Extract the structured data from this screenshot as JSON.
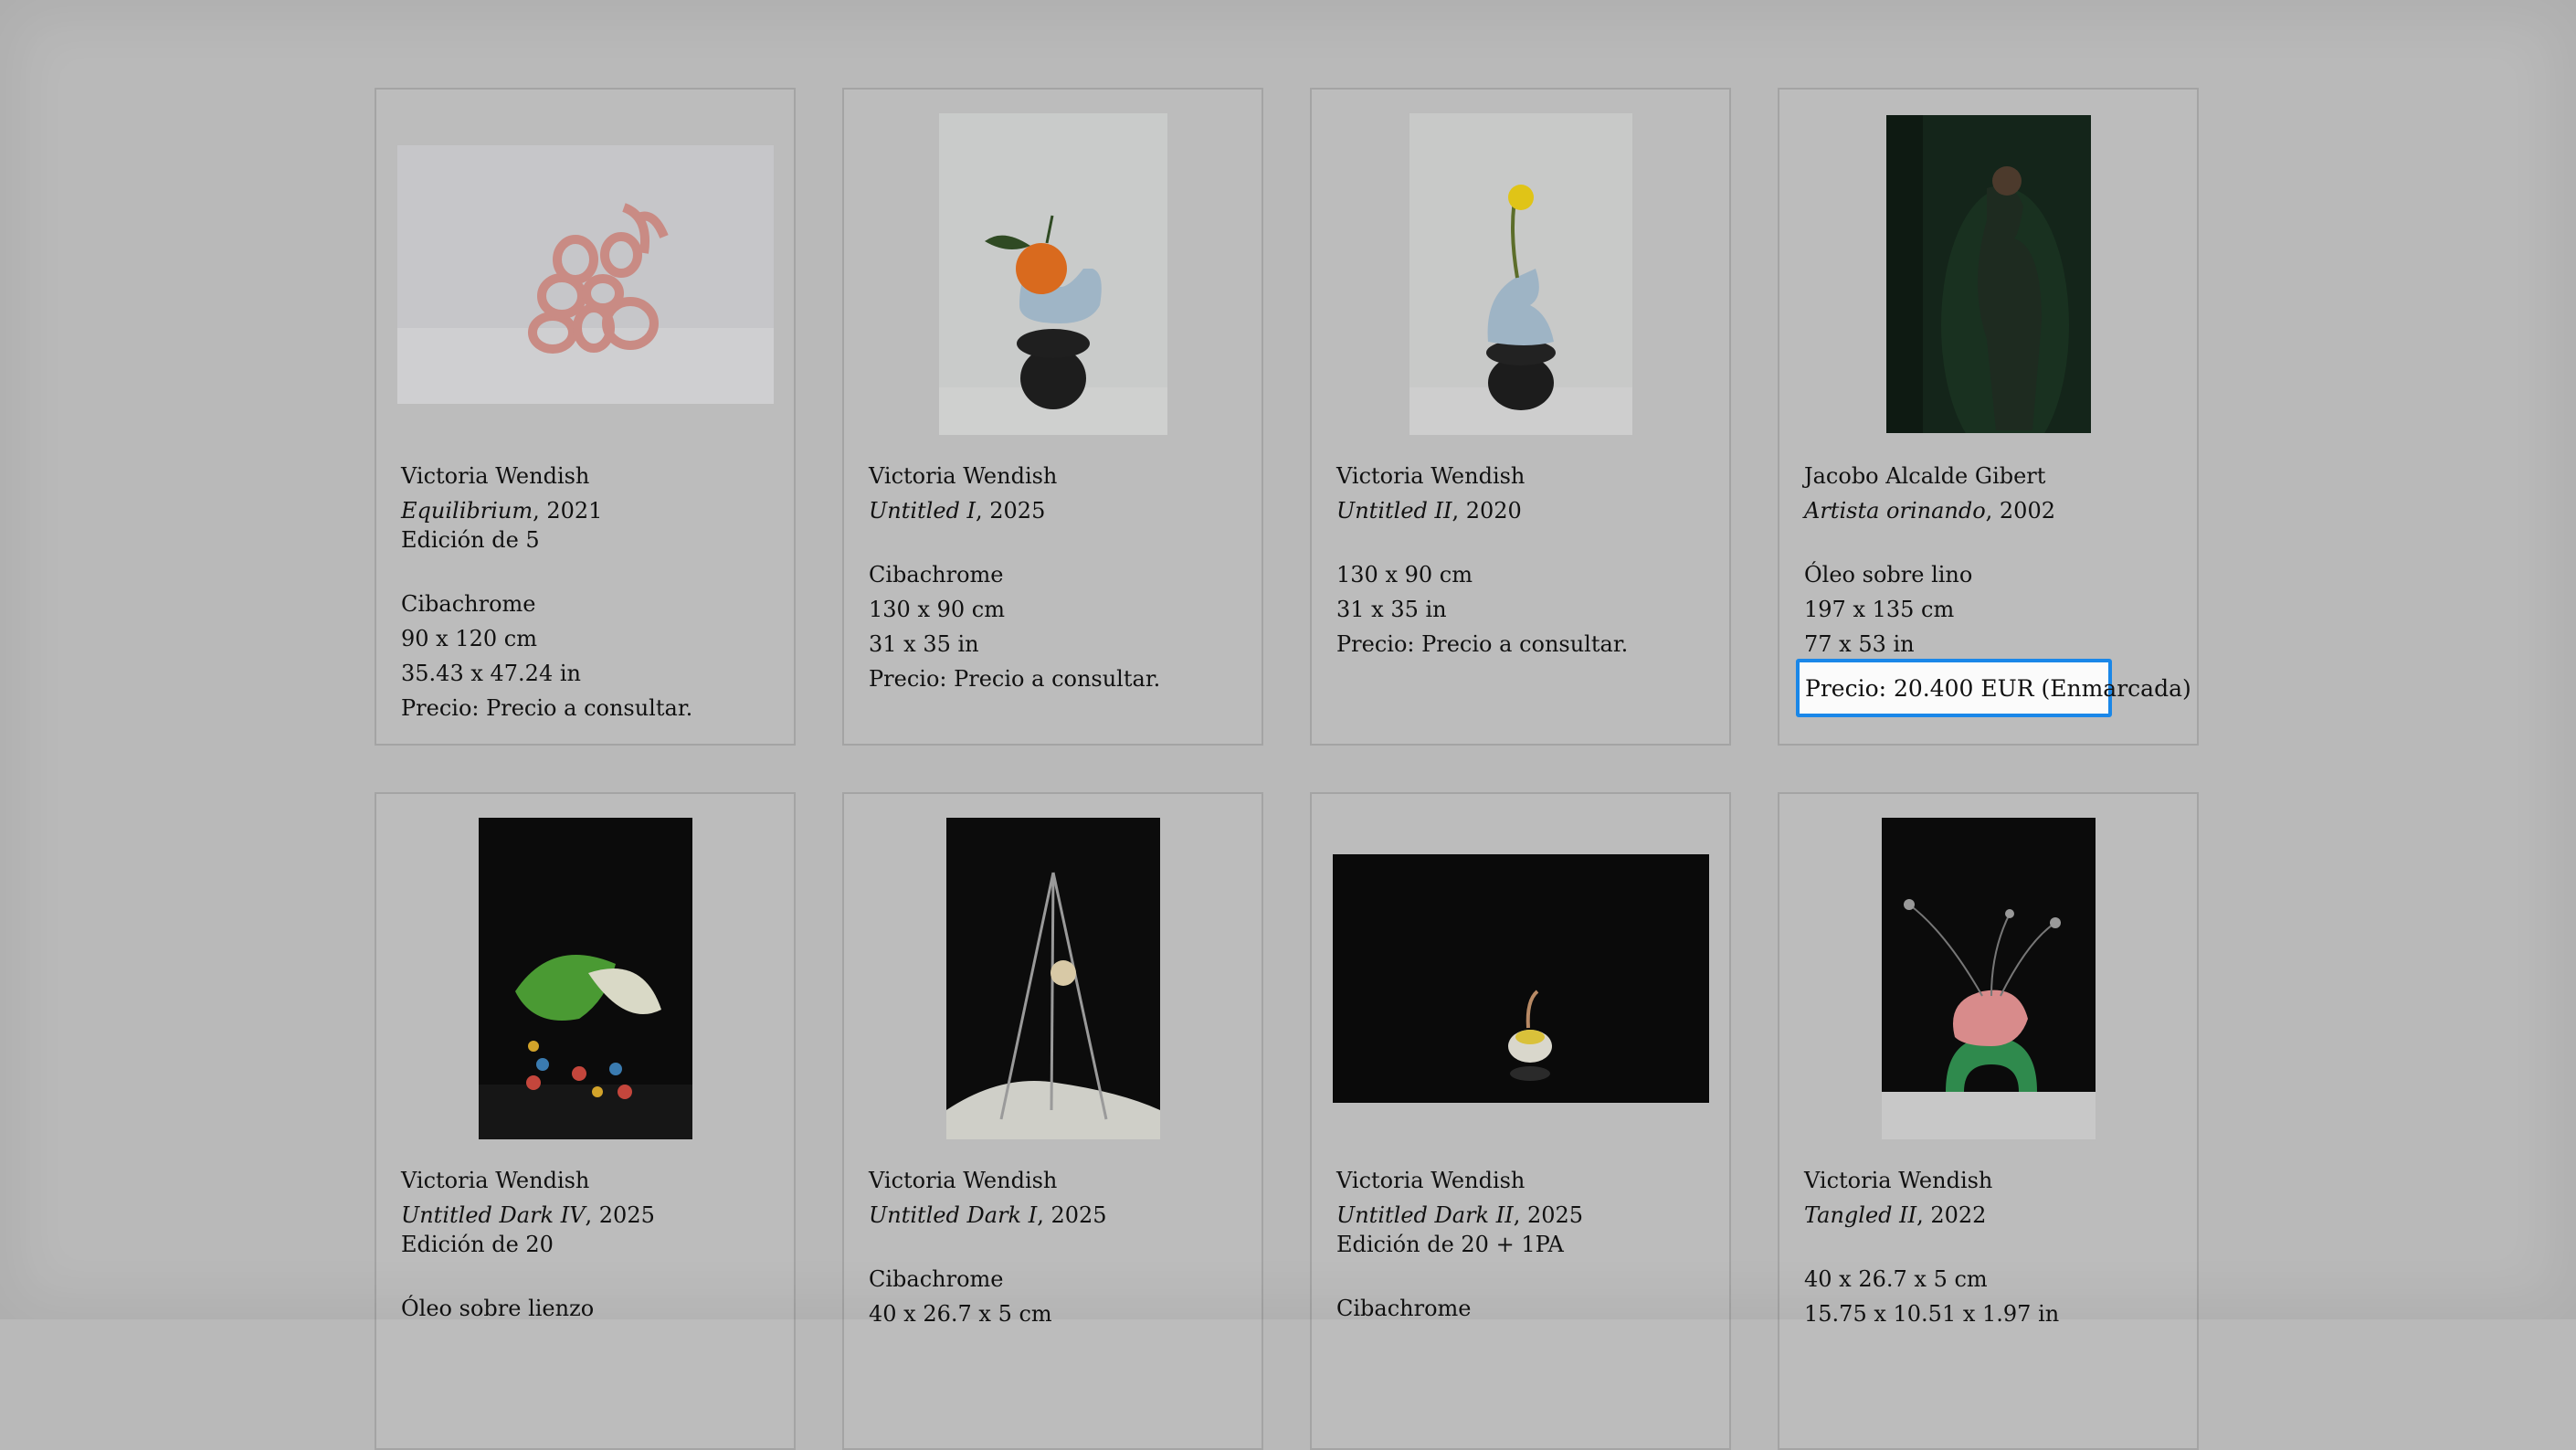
{
  "artworks": [
    {
      "artist": "Victoria Wendish",
      "title": "Equilibrium",
      "year": ", 2021",
      "edition": "Edición de 5",
      "medium": "Cibachrome",
      "size_cm": "90 x 120 cm",
      "size_in": "35.43 x 47.24 in",
      "price": "Precio: Precio a consultar.",
      "image_icon": "pink-ribbon-sculpture"
    },
    {
      "artist": "Victoria Wendish",
      "title": "Untitled I",
      "year": ", 2025",
      "medium": "Cibachrome",
      "size_cm": "130 x 90 cm",
      "size_in": "31 x 35 in",
      "price": "Precio: Precio a consultar.",
      "image_icon": "orange-on-blue-sculpture"
    },
    {
      "artist": "Victoria Wendish",
      "title": "Untitled II",
      "year": ", 2020",
      "size_cm": "130 x 90 cm",
      "size_in": "31 x 35 in",
      "price": "Precio: Precio a consultar.",
      "image_icon": "yellow-flower-sculpture"
    },
    {
      "artist": "Jacobo Alcalde Gibert",
      "title": "Artista orinando",
      "year": ", 2002",
      "medium": "Óleo sobre lino",
      "size_cm": "197 x 135 cm",
      "size_in": "77 x 53 in",
      "price": "Precio: 20.400 EUR (Enmarcada)",
      "image_icon": "portrait-painting"
    },
    {
      "artist": "Victoria Wendish",
      "title": "Untitled Dark IV",
      "year": ", 2025",
      "edition": "Edición de 20",
      "medium": "Óleo sobre lienzo",
      "image_icon": "anthurium-dark"
    },
    {
      "artist": "Victoria Wendish",
      "title": "Untitled Dark I",
      "year": ", 2025",
      "medium": "Cibachrome",
      "size_cm": "40 x 26.7 x 5 cm",
      "image_icon": "dried-flower-dark"
    },
    {
      "artist": "Victoria Wendish",
      "title": "Untitled Dark II",
      "year": ", 2025",
      "edition": "Edición de 20 + 1PA",
      "medium": "Cibachrome",
      "image_icon": "bowl-dark"
    },
    {
      "artist": "Victoria Wendish",
      "title": "Tangled II",
      "year": ", 2022",
      "size_cm": "40 x 26.7 x 5 cm",
      "size_in": "15.75 x 10.51 x 1.97 in",
      "image_icon": "pink-green-sculpture-dark"
    }
  ],
  "highlight_color": "#1a87e8"
}
